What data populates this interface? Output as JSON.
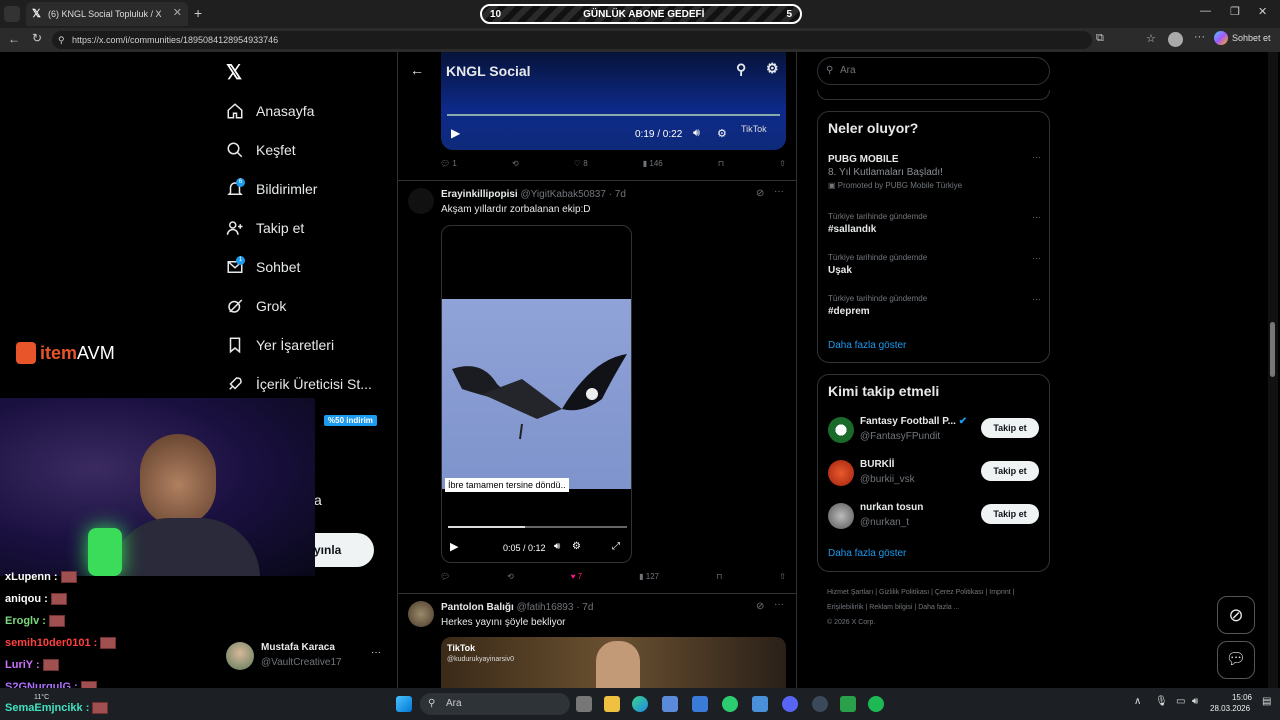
{
  "browser": {
    "tab_title": "(6) KNGL Social Topluluk / X",
    "url": "https://x.com/i/communities/1895084128954933746",
    "profile_label": "Sohbet et"
  },
  "overlay": {
    "goal_left": "10",
    "goal_title": "GÜNLÜK ABONE GEDEFİ",
    "goal_right": "5",
    "sponsor_brand_1": "item",
    "sponsor_brand_2": "AVM",
    "sponsor_discount": "%50 indirim"
  },
  "nav": {
    "home": "Anasayfa",
    "explore": "Keşfet",
    "notifications": "Bildirimler",
    "follow": "Takip et",
    "chat": "Sohbet",
    "grok": "Grok",
    "bookmarks": "Yer İşaretleri",
    "creator": "İçerik Üreticisi St...",
    "partial_more": "a",
    "post_button_partial": "yınla",
    "notif_badge": "6",
    "chat_badge": "1",
    "user_name": "Mustafa Karaca",
    "user_handle": "@VaultCreative17"
  },
  "center": {
    "title": "KNGL Social",
    "video1_time": "0:19 / 0:22",
    "video1_watermark": "TikTok",
    "tweet1_actions": {
      "replies": "1",
      "likes": "8",
      "views": "146"
    },
    "tweet2": {
      "name": "Erayinkillipopisi",
      "handle": "@YigitKabak50837 · 7d",
      "text": "Akşam yıllardır zorbalanan ekip:D",
      "caption": "İbre tamamen tersine döndü..",
      "video_time": "0:05 / 0:12",
      "likes": "7",
      "views": "127"
    },
    "tweet3": {
      "name": "Pantolon Balığı",
      "handle": "@fatih16893 · 7d",
      "text": "Herkes yayını şöyle bekliyor",
      "watermark": "TikTok",
      "watermark_handle": "@kudurukyayinarsiv0"
    }
  },
  "right": {
    "search_placeholder": "Ara",
    "trends_title": "Neler oluyor?",
    "trends": [
      {
        "small": "",
        "big": "PUBG MOBILE",
        "sub": "8. Yıl Kutlamaları Başladı!",
        "promo": "Promoted by PUBG Mobile Türkiye"
      },
      {
        "small": "Türkiye tarihinde gündemde",
        "big": "#sallandık"
      },
      {
        "small": "Türkiye tarihinde gündemde",
        "big": "Uşak"
      },
      {
        "small": "Türkiye tarihinde gündemde",
        "big": "#deprem"
      }
    ],
    "show_more": "Daha fazla göster",
    "who_title": "Kimi takip etmeli",
    "who": [
      {
        "name": "Fantasy Football P...",
        "handle": "@FantasyFPundit",
        "btn": "Takip et"
      },
      {
        "name": "BURKİİ",
        "handle": "@burkii_vsk",
        "btn": "Takip et"
      },
      {
        "name": "nurkan tosun",
        "handle": "@nurkan_t",
        "btn": "Takip et"
      }
    ],
    "footer": [
      "Hizmet Şartları",
      "Gizlilik Politikası",
      "Çerez Politikası",
      "Imprint",
      "Erişilebilirlik",
      "Reklam bilgisi",
      "Daha fazla ...",
      "© 2026 X Corp."
    ]
  },
  "chat": [
    {
      "user": "xLupenn :",
      "color": "#ffffff"
    },
    {
      "user": "aniqou :",
      "color": "#ffffff"
    },
    {
      "user": "Eroglv :",
      "color": "#7dd87d"
    },
    {
      "user": "semih10der0101 :",
      "color": "#ff4040"
    },
    {
      "user": "LuriY :",
      "color": "#d070ff"
    },
    {
      "user": "S2GNurqulG :",
      "color": "#b070ff"
    },
    {
      "user": "SemaEmjncikk :",
      "color": "#40e0c0"
    }
  ],
  "taskbar": {
    "search": "Ara",
    "weather": "11°C",
    "time": "15:06",
    "date": "28.03.2026"
  }
}
